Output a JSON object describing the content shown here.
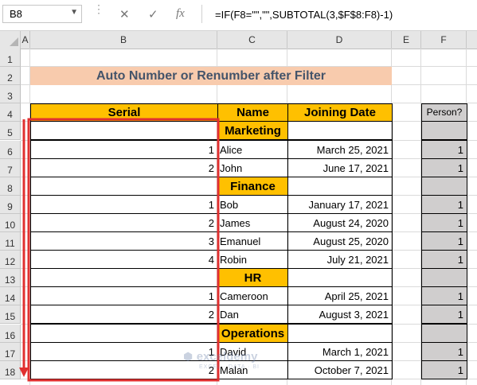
{
  "formula_bar": {
    "name_box": "B8",
    "cancel_icon": "✕",
    "enter_icon": "✓",
    "fx_icon": "fx",
    "formula": "=IF(F8=\"\",\"\",SUBTOTAL(3,$F$8:F8)-1)"
  },
  "columns": [
    "A",
    "B",
    "C",
    "D",
    "E",
    "F"
  ],
  "rows": [
    "1",
    "2",
    "3",
    "4",
    "5",
    "6",
    "7",
    "8",
    "9",
    "10",
    "11",
    "12",
    "13",
    "14",
    "15",
    "16",
    "17",
    "18"
  ],
  "title": "Auto Number or Renumber after Filter",
  "headers": {
    "serial": "Serial",
    "name": "Name",
    "date": "Joining Date",
    "person": "Person?"
  },
  "table": [
    {
      "serial": "",
      "name": "Marketing",
      "date": "",
      "person": "",
      "dept": true
    },
    {
      "serial": "1",
      "name": "Alice",
      "date": "March 25, 2021",
      "person": "1"
    },
    {
      "serial": "2",
      "name": "John",
      "date": "June 17, 2021",
      "person": "1"
    },
    {
      "serial": "",
      "name": "Finance",
      "date": "",
      "person": "",
      "dept": true
    },
    {
      "serial": "1",
      "name": "Bob",
      "date": "January 17, 2021",
      "person": "1"
    },
    {
      "serial": "2",
      "name": "James",
      "date": "August 24, 2020",
      "person": "1"
    },
    {
      "serial": "3",
      "name": "Emanuel",
      "date": "August 25, 2020",
      "person": "1"
    },
    {
      "serial": "4",
      "name": "Robin",
      "date": "July 21, 2021",
      "person": "1"
    },
    {
      "serial": "",
      "name": "HR",
      "date": "",
      "person": "",
      "dept": true
    },
    {
      "serial": "1",
      "name": "Cameroon",
      "date": "April 25, 2021",
      "person": "1"
    },
    {
      "serial": "2",
      "name": "Dan",
      "date": "August 3, 2021",
      "person": "1"
    },
    {
      "serial": "",
      "name": "Operations",
      "date": "",
      "person": "",
      "dept": true
    },
    {
      "serial": "1",
      "name": "David",
      "date": "March 1, 2021",
      "person": "1"
    },
    {
      "serial": "2",
      "name": "Malan",
      "date": "October 7, 2021",
      "person": "1"
    }
  ],
  "watermark": {
    "brand": "exceldemy",
    "tagline": "EXCEL · DATA · BI"
  },
  "colors": {
    "orange": "#ffc000",
    "title_bg": "#f8cbad",
    "title_text": "#44546a",
    "gray": "#d0cece",
    "highlight": "#e03030"
  }
}
